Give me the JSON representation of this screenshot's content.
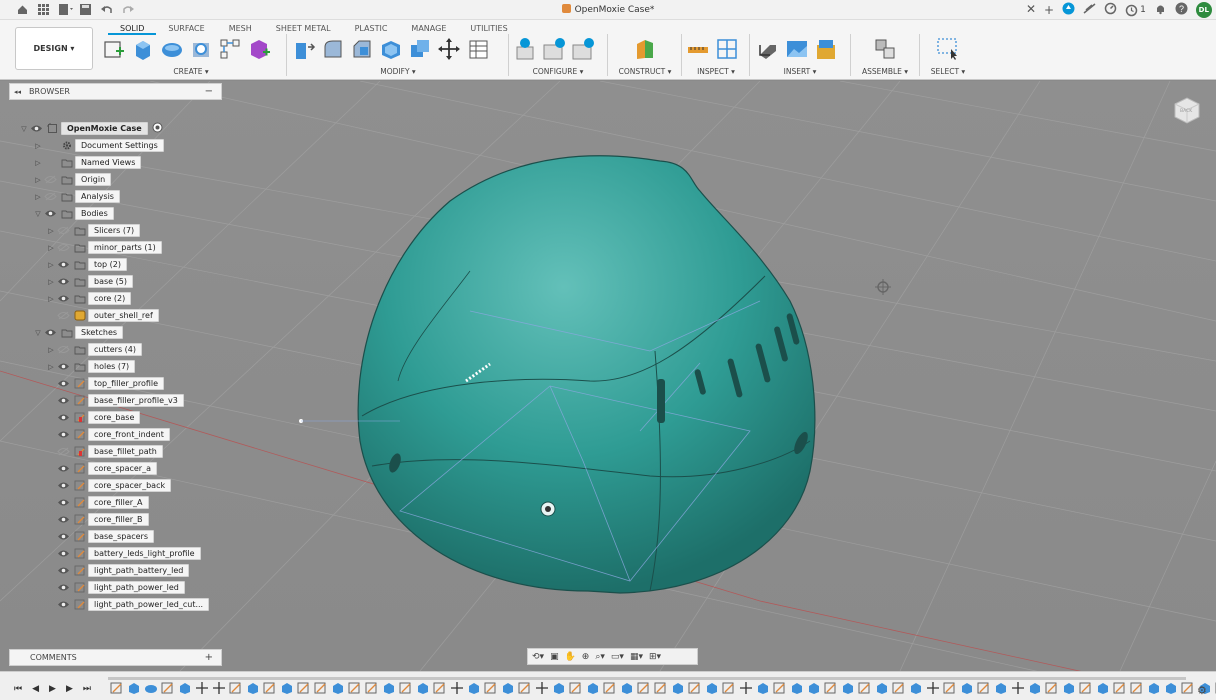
{
  "window": {
    "title": "OpenMoxie Case*",
    "notification_count": "1",
    "user_initials": "DL"
  },
  "toolbar": {
    "workspace_button": "DESIGN",
    "tabs": [
      {
        "label": "SOLID",
        "active": true
      },
      {
        "label": "SURFACE",
        "active": false
      },
      {
        "label": "MESH",
        "active": false
      },
      {
        "label": "SHEET METAL",
        "active": false
      },
      {
        "label": "PLASTIC",
        "active": false
      },
      {
        "label": "MANAGE",
        "active": false
      },
      {
        "label": "UTILITIES",
        "active": false
      }
    ],
    "groups": [
      {
        "label": "CREATE"
      },
      {
        "label": "MODIFY"
      },
      {
        "label": "CONFIGURE"
      },
      {
        "label": "CONSTRUCT"
      },
      {
        "label": "INSPECT"
      },
      {
        "label": "INSERT"
      },
      {
        "label": "ASSEMBLE"
      },
      {
        "label": "SELECT"
      }
    ]
  },
  "browser": {
    "title": "BROWSER",
    "items": [
      {
        "label": "OpenMoxie Case",
        "level": 0,
        "expanded": true,
        "icon": "component-icon",
        "root": true
      },
      {
        "label": "Document Settings",
        "level": 1,
        "icon": "gear-icon",
        "noeye": true
      },
      {
        "label": "Named Views",
        "level": 1,
        "icon": "folder-icon",
        "noeye": true
      },
      {
        "label": "Origin",
        "level": 1,
        "icon": "folder-icon",
        "eye": "hidden"
      },
      {
        "label": "Analysis",
        "level": 1,
        "icon": "folder-icon",
        "eye": "hidden"
      },
      {
        "label": "Bodies",
        "level": 1,
        "icon": "folder-icon",
        "expanded": true
      },
      {
        "label": "Slicers (7)",
        "level": 2,
        "icon": "folder-icon",
        "eye": "hidden"
      },
      {
        "label": "minor_parts (1)",
        "level": 2,
        "icon": "folder-icon",
        "eye": "hidden"
      },
      {
        "label": "top (2)",
        "level": 2,
        "icon": "folder-icon"
      },
      {
        "label": "base (5)",
        "level": 2,
        "icon": "folder-icon"
      },
      {
        "label": "core (2)",
        "level": 2,
        "icon": "folder-icon"
      },
      {
        "label": "outer_shell_ref",
        "level": 2,
        "icon": "body-icon",
        "eye": "hidden",
        "noarrow": true
      },
      {
        "label": "Sketches",
        "level": 1,
        "icon": "folder-icon",
        "expanded": true
      },
      {
        "label": "cutters (4)",
        "level": 2,
        "icon": "folder-icon",
        "eye": "hidden"
      },
      {
        "label": "holes (7)",
        "level": 2,
        "icon": "folder-icon"
      },
      {
        "label": "top_filler_profile",
        "level": 2,
        "icon": "sketch-icon",
        "noarrow": true
      },
      {
        "label": "base_filler_profile_v3",
        "level": 2,
        "icon": "sketch-icon",
        "noarrow": true
      },
      {
        "label": "core_base",
        "level": 2,
        "icon": "sketch-error-icon",
        "noarrow": true
      },
      {
        "label": "core_front_indent",
        "level": 2,
        "icon": "sketch-icon",
        "noarrow": true
      },
      {
        "label": "base_fillet_path",
        "level": 2,
        "icon": "sketch-error-icon",
        "eye": "hidden",
        "noarrow": true
      },
      {
        "label": "core_spacer_a",
        "level": 2,
        "icon": "sketch-icon",
        "noarrow": true
      },
      {
        "label": "core_spacer_back",
        "level": 2,
        "icon": "sketch-icon",
        "noarrow": true
      },
      {
        "label": "core_filler_A",
        "level": 2,
        "icon": "sketch-icon",
        "noarrow": true
      },
      {
        "label": "core_filler_B",
        "level": 2,
        "icon": "sketch-icon",
        "noarrow": true
      },
      {
        "label": "base_spacers",
        "level": 2,
        "icon": "sketch-icon",
        "noarrow": true
      },
      {
        "label": "battery_leds_light_profile",
        "level": 2,
        "icon": "sketch-icon",
        "noarrow": true
      },
      {
        "label": "light_path_battery_led",
        "level": 2,
        "icon": "sketch-icon",
        "noarrow": true
      },
      {
        "label": "light_path_power_led",
        "level": 2,
        "icon": "sketch-icon",
        "noarrow": true
      },
      {
        "label": "light_path_power_led_cut...",
        "level": 2,
        "icon": "sketch-icon",
        "noarrow": true
      }
    ]
  },
  "comments": {
    "title": "COMMENTS"
  },
  "viewcube": {
    "label": "BACK"
  },
  "colors": {
    "accent": "#0696d7",
    "body": "#2e9c94",
    "viewport": "#8c8c8c"
  }
}
